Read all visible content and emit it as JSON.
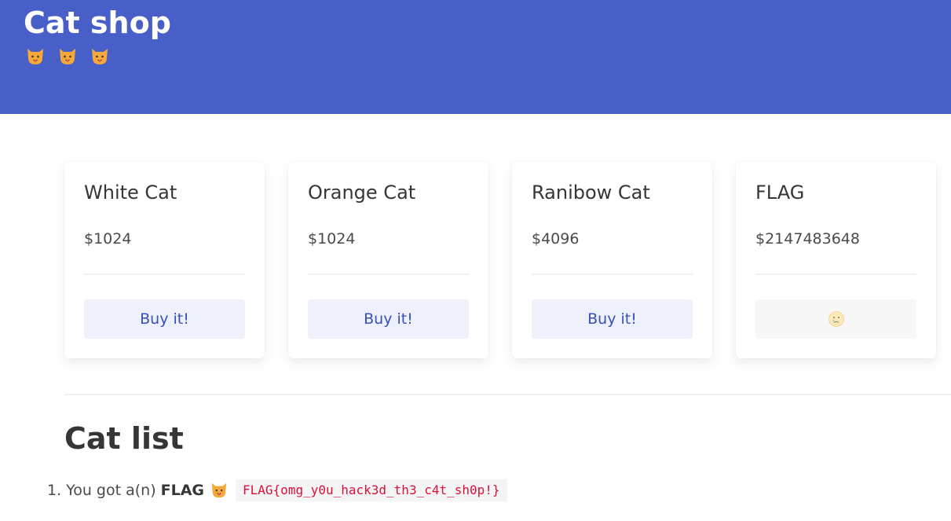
{
  "header": {
    "title": "Cat shop",
    "icons": [
      "cat-face-icon",
      "cat-face-icon",
      "cat-face-icon"
    ]
  },
  "products": [
    {
      "name": "White Cat",
      "price": "$1024",
      "button": "Buy it!"
    },
    {
      "name": "Orange Cat",
      "price": "$1024",
      "button": "Buy it!"
    },
    {
      "name": "Ranibow Cat",
      "price": "$4096",
      "button": "Buy it!"
    },
    {
      "name": "FLAG",
      "price": "$2147483648",
      "button_icon": "crying-face-icon"
    }
  ],
  "cat_list": {
    "title": "Cat list",
    "items": [
      {
        "number": "1.",
        "prefix": "You got a(n)",
        "name": "FLAG",
        "icon": "cat-face-icon",
        "code": "FLAG{omg_y0u_hack3d_th3_c4t_sh0p!}"
      }
    ]
  },
  "colors": {
    "hero_bg": "#485fc7",
    "button_bg": "#eef0fb",
    "button_text": "#3850b7",
    "code_text": "#da1039"
  }
}
